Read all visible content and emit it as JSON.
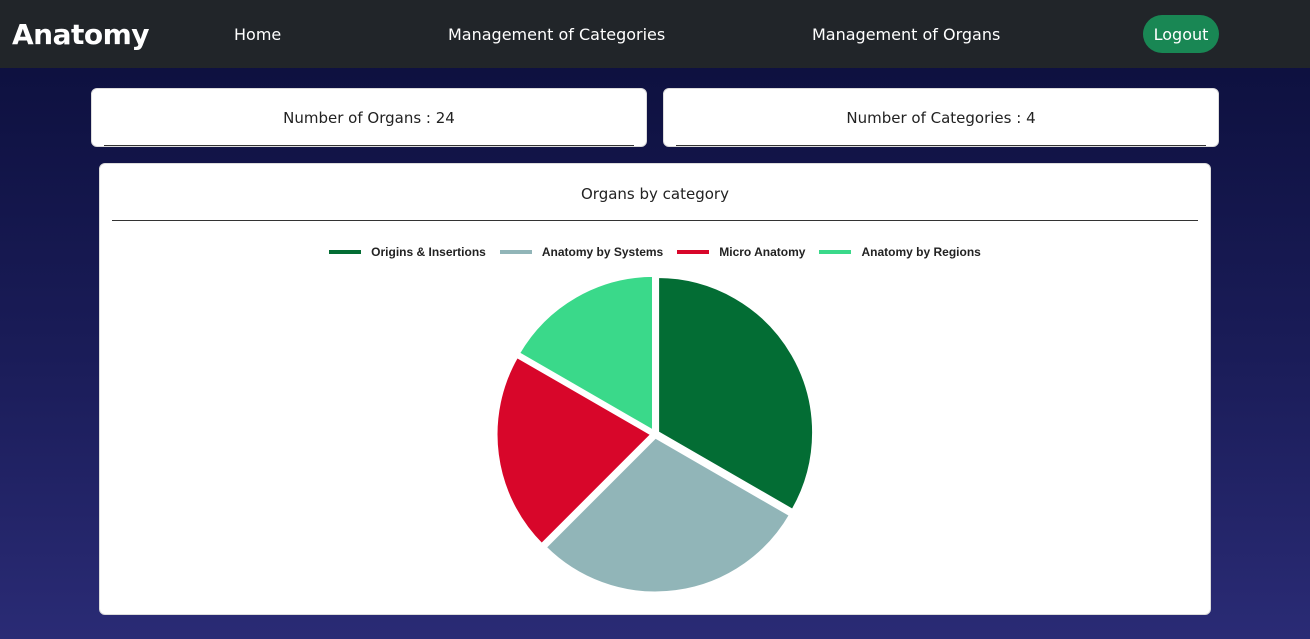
{
  "navbar": {
    "brand": "Anatomy",
    "links": [
      "Home",
      "Management of Categories",
      "Management of Organs"
    ],
    "logout_label": "Logout",
    "logout_color": "#198754"
  },
  "stats": {
    "organs_label": "Number of Organs : 24",
    "categories_label": "Number of Categories : 4"
  },
  "chart_data": {
    "type": "pie",
    "title": "Organs by category",
    "legend_position": "top",
    "categories": [
      "Origins & Insertions",
      "Anatomy by Systems",
      "Micro Anatomy",
      "Anatomy by Regions"
    ],
    "values": [
      8,
      7,
      5,
      4
    ],
    "colors": [
      "#036d34",
      "#91b5b8",
      "#d8062a",
      "#3ad98a"
    ]
  }
}
